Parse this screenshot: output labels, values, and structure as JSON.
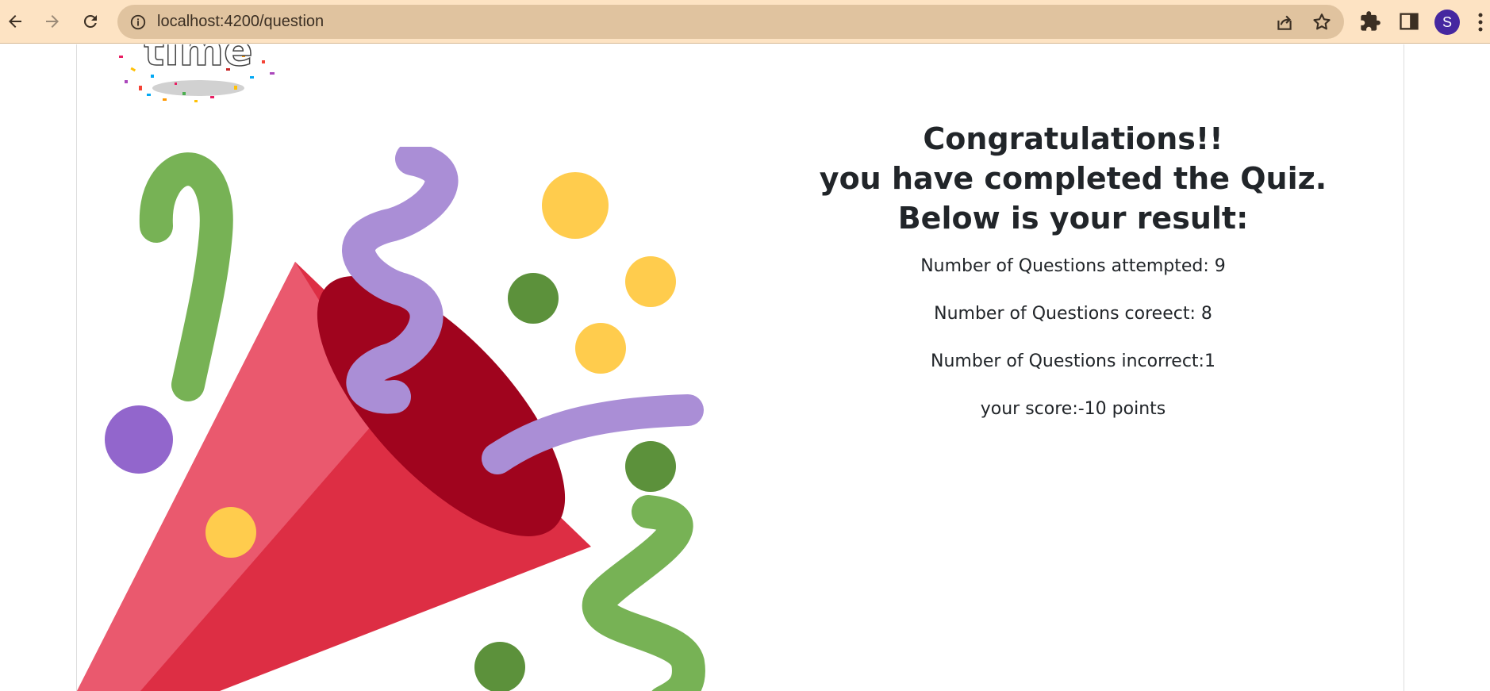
{
  "browser": {
    "url": "localhost:4200/question",
    "profile_initial": "S",
    "theme_color": "#fde3c3",
    "omnibox_color": "#e0c39f",
    "icons": [
      "back-icon",
      "forward-icon",
      "reload-icon",
      "info-icon",
      "share-icon",
      "star-icon",
      "extensions-icon",
      "side-panel-icon",
      "menu-icon"
    ]
  },
  "logo": {
    "text": "time"
  },
  "result": {
    "heading_line1": "Congratulations!!",
    "heading_line2": "you have completed the Quiz.",
    "heading_line3": "Below is your result:",
    "attempted": "Number of Questions attempted: 9",
    "correct": "Number of Questions coreect: 8",
    "incorrect": "Number of Questions incorrect:1",
    "score": "your score:-10 points"
  },
  "colors": {
    "cone_red": "#dd2e44",
    "cone_light": "#ea596e",
    "cone_dark": "#a0041e",
    "purple": "#aa8ed6",
    "green": "#77b255",
    "dark_green": "#5c913b",
    "yellow": "#ffcc4d",
    "violet": "#9266cc"
  }
}
